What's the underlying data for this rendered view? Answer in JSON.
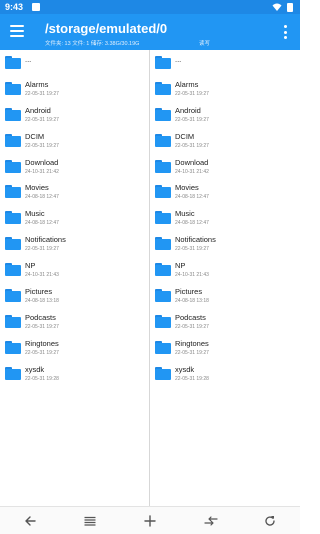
{
  "status_bar": {
    "time": "9:43"
  },
  "app_bar": {
    "path": "/storage/emulated/0",
    "info": "文件夹: 13 文件: 1 储存: 3.38G/30.19G",
    "mode": "读写"
  },
  "left_pane": {
    "parent": "...",
    "items": [
      {
        "name": "Alarms",
        "date": "22-05-31 19:27"
      },
      {
        "name": "Android",
        "date": "22-05-31 19:27"
      },
      {
        "name": "DCIM",
        "date": "22-05-31 19:27"
      },
      {
        "name": "Download",
        "date": "24-10-31 21:42"
      },
      {
        "name": "Movies",
        "date": "24-08-18 12:47"
      },
      {
        "name": "Music",
        "date": "24-08-18 12:47"
      },
      {
        "name": "Notifications",
        "date": "22-05-31 19:27"
      },
      {
        "name": "NP",
        "date": "24-10-31 21:43"
      },
      {
        "name": "Pictures",
        "date": "24-08-18 13:18"
      },
      {
        "name": "Podcasts",
        "date": "22-05-31 19:27"
      },
      {
        "name": "Ringtones",
        "date": "22-05-31 19:27"
      },
      {
        "name": "xysdk",
        "date": "22-05-31 19:28"
      }
    ]
  },
  "right_pane": {
    "parent": "...",
    "items": [
      {
        "name": "Alarms",
        "date": "22-05-31 19:27"
      },
      {
        "name": "Android",
        "date": "22-05-31 19:27"
      },
      {
        "name": "DCIM",
        "date": "22-05-31 19:27"
      },
      {
        "name": "Download",
        "date": "24-10-31 21:42"
      },
      {
        "name": "Movies",
        "date": "24-08-18 12:47"
      },
      {
        "name": "Music",
        "date": "24-08-18 12:47"
      },
      {
        "name": "Notifications",
        "date": "22-05-31 19:27"
      },
      {
        "name": "NP",
        "date": "24-10-31 21:43"
      },
      {
        "name": "Pictures",
        "date": "24-08-18 13:18"
      },
      {
        "name": "Podcasts",
        "date": "22-05-31 19:27"
      },
      {
        "name": "Ringtones",
        "date": "22-05-31 19:27"
      },
      {
        "name": "xysdk",
        "date": "22-05-31 19:28"
      }
    ]
  },
  "bottom_bar": {
    "icons": [
      "back-arrow-icon",
      "list-icon",
      "plus-icon",
      "swap-icon",
      "refresh-icon"
    ]
  },
  "colors": {
    "accent": "#2196f3",
    "status_bar": "#1e88e5"
  }
}
